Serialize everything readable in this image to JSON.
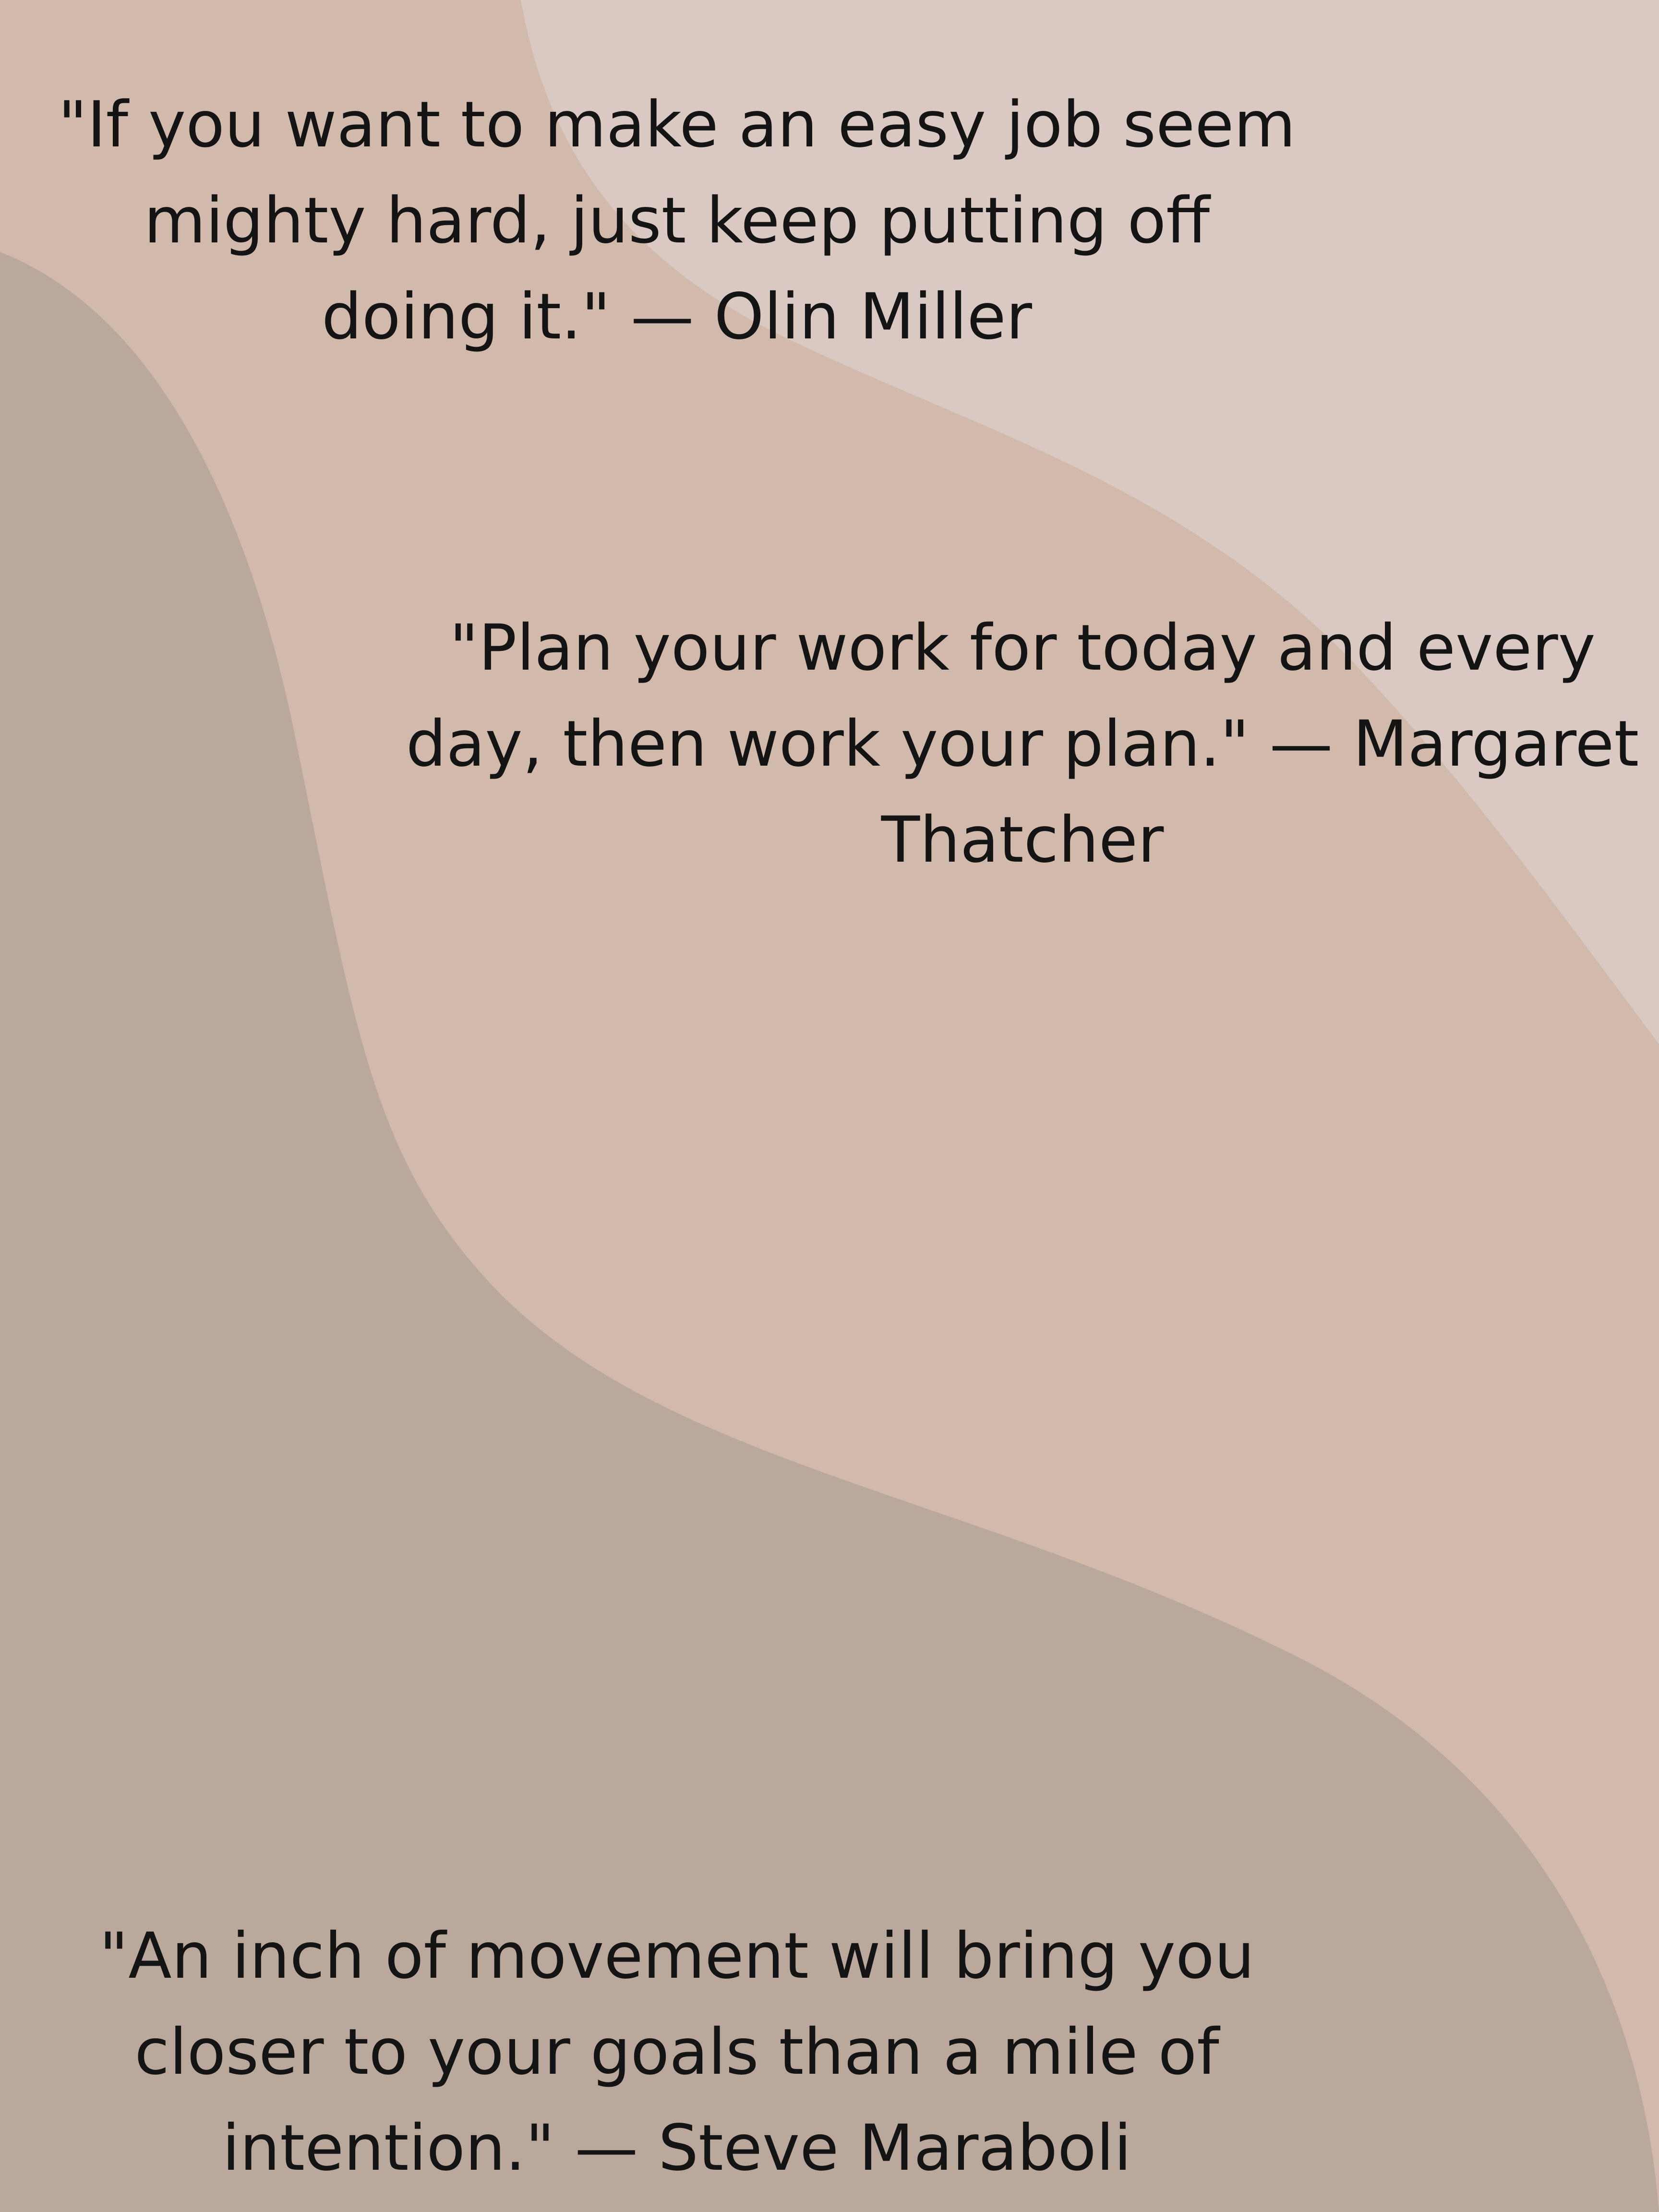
{
  "colors": {
    "background": "#d1b9ab",
    "top_right_wave": "#d9c9c2",
    "bottom_left_wave": "#baa89c",
    "text": "#141414"
  },
  "quotes": [
    {
      "lines": [
        "\"If you want to make an easy job seem",
        "mighty hard, just keep putting off",
        "doing it.\" — Olin Miller"
      ]
    },
    {
      "lines": [
        "\"Plan your work for today and every",
        "day, then work your plan.\" — Margaret",
        "Thatcher"
      ]
    },
    {
      "lines": [
        "\"An inch of movement will bring you",
        "closer to your goals than a mile of",
        "intention.\" — Steve Maraboli"
      ]
    }
  ]
}
